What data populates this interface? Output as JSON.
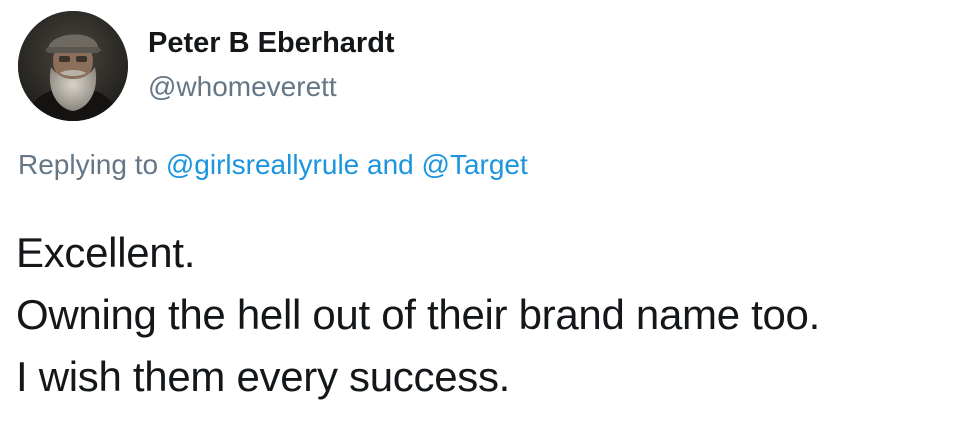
{
  "author": {
    "avatar_icon": "profile-photo",
    "display_name": "Peter B Eberhardt",
    "handle": "@whomeverett"
  },
  "reply": {
    "prefix": "Replying to",
    "mentions": [
      "@girlsreallyrule",
      "@Target"
    ],
    "conjunction": "and"
  },
  "tweet": {
    "lines": [
      "Excellent.",
      "Owning the hell out of their brand name too.",
      "I wish them every success."
    ]
  },
  "colors": {
    "text": "#14171a",
    "secondary": "#657786",
    "link": "#1b95e0",
    "background": "#ffffff"
  }
}
